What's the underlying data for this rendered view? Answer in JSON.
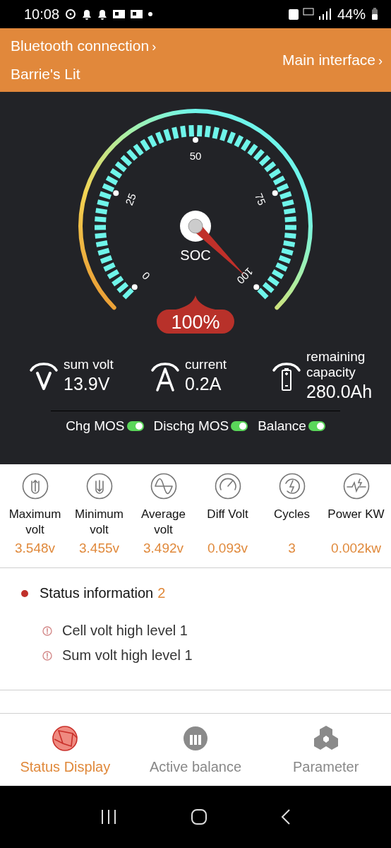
{
  "status_bar": {
    "time": "10:08",
    "battery": "44%"
  },
  "header": {
    "connection_link": "Bluetooth connection",
    "connection_chevron": "›",
    "device_name": "Barrie's Lit",
    "main_link": "Main interface",
    "main_chevron": "›"
  },
  "gauge": {
    "label": "SOC",
    "reading": "100%",
    "ticks": [
      "0",
      "25",
      "50",
      "75",
      "100"
    ]
  },
  "readings": [
    {
      "kind": "volt",
      "label": "sum volt",
      "value": "13.9V"
    },
    {
      "kind": "amp",
      "label": "current",
      "value": "0.2A"
    },
    {
      "kind": "battery",
      "label": "remaining capacity",
      "value": "280.0Ah"
    }
  ],
  "switches": [
    {
      "label": "Chg MOS",
      "on": true
    },
    {
      "label": "Dischg MOS",
      "on": true
    },
    {
      "label": "Balance",
      "on": true
    }
  ],
  "metrics": [
    {
      "kind": "max",
      "label": "Maximum volt",
      "value": "3.548v"
    },
    {
      "kind": "min",
      "label": "Minimum volt",
      "value": "3.455v"
    },
    {
      "kind": "avg",
      "label": "Average volt",
      "value": "3.492v"
    },
    {
      "kind": "diff",
      "label": "Diff Volt",
      "value": "0.093v"
    },
    {
      "kind": "cycles",
      "label": "Cycles",
      "value": "3"
    },
    {
      "kind": "power",
      "label": "Power KW",
      "value": "0.002kw"
    }
  ],
  "status_info": {
    "title": "Status information",
    "count": "2",
    "items": [
      "Cell volt high level 1",
      "Sum volt high level 1"
    ]
  },
  "tabs": [
    {
      "kind": "status",
      "label": "Status Display",
      "selected": true
    },
    {
      "kind": "balance",
      "label": "Active balance",
      "selected": false
    },
    {
      "kind": "parameter",
      "label": "Parameter",
      "selected": false
    }
  ]
}
